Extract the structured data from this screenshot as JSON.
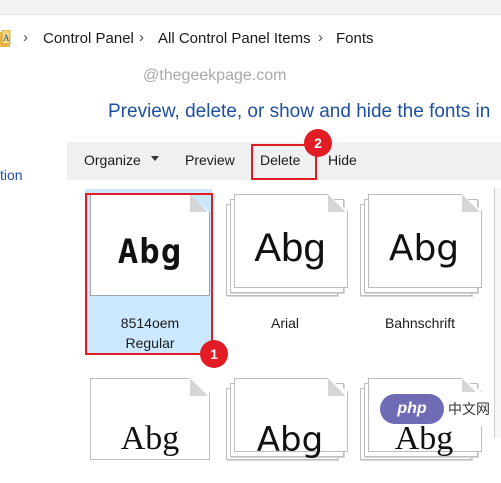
{
  "address_bar": {
    "breadcrumbs": [
      "Control Panel",
      "All Control Panel Items",
      "Fonts"
    ]
  },
  "watermark": "@thegeekpage.com",
  "heading": "Preview, delete, or show and hide the fonts in",
  "left_pane_fragment": "tion",
  "toolbar": {
    "organize_label": "Organize",
    "preview_label": "Preview",
    "delete_label": "Delete",
    "hide_label": "Hide"
  },
  "fonts": [
    {
      "sample": "Abg",
      "name_line1": "8514oem",
      "name_line2": "Regular",
      "selected": true
    },
    {
      "sample": "Abg",
      "name_line1": "Arial",
      "name_line2": ""
    },
    {
      "sample": "Abg",
      "name_line1": "Bahnschrift",
      "name_line2": ""
    }
  ],
  "bottom_row_samples": [
    "Abg",
    "Abg",
    "Abg"
  ],
  "annotations": {
    "step1": "1",
    "step2": "2"
  },
  "php_watermark": {
    "logo": "php",
    "text": "中文网"
  },
  "colors": {
    "accent_red": "#e21c24",
    "heading_blue": "#1e4fa0",
    "selection": "#cce8ff"
  }
}
